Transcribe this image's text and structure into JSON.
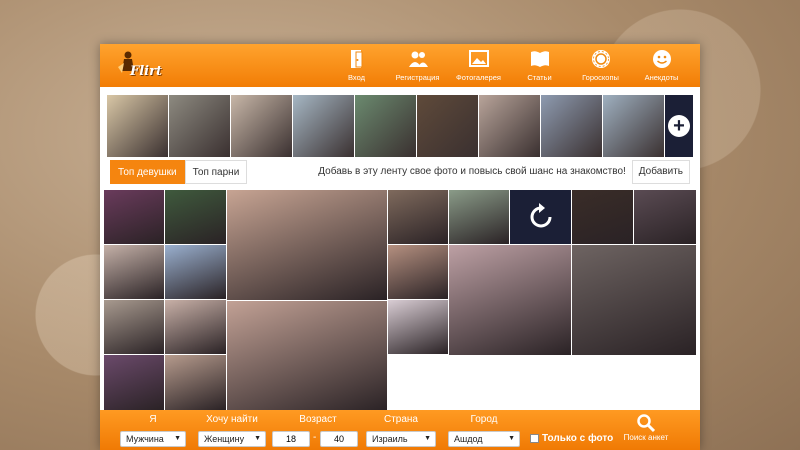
{
  "header": {
    "logo_text": "Flirt",
    "nav": [
      {
        "label": "Вход",
        "icon": "door-icon"
      },
      {
        "label": "Регистрация",
        "icon": "users-icon"
      },
      {
        "label": "Фотогалерея",
        "icon": "image-icon"
      },
      {
        "label": "Статьи",
        "icon": "book-icon"
      },
      {
        "label": "Гороскопы",
        "icon": "zodiac-icon"
      },
      {
        "label": "Анекдоты",
        "icon": "smile-icon"
      }
    ]
  },
  "strip": {
    "photos": [
      "#d9c7a6",
      "#8d8a80",
      "#c8b7a8",
      "#a6b7c4",
      "#6b8a6f",
      "#5f4a3a",
      "#b8a49a",
      "#8e9bb0",
      "#9fb0c0"
    ],
    "add_icon": "plus-icon"
  },
  "tabs": {
    "top_girls": "Топ девушки",
    "top_guys": "Топ парни",
    "promo": "Добавь в эту ленту свое фото и повысь свой шанс на знакомство!",
    "add_button": "Добавить"
  },
  "grid": {
    "refresh_icon": "refresh-icon",
    "colors": [
      "#6a3b5c",
      "#3f5a3d",
      "#c7a493",
      "#7f6a5d",
      "#8a9b88",
      "#3a2d28",
      "#5a4b53",
      "#c5b1a8",
      "#9ab0cf",
      "#b59080",
      "#bda0a4",
      "#6e6462",
      "#a89a8f",
      "#c8b0a7",
      "#c2a195",
      "#d9cdd4",
      "#6b4a6b",
      "#b69b8d",
      "#d2c0b7"
    ]
  },
  "filter": {
    "i_label": "Я",
    "i_value": "Мужчина",
    "want_label": "Хочу найти",
    "want_value": "Женщину",
    "age_label": "Возраст",
    "age_from": "18",
    "age_to": "40",
    "country_label": "Страна",
    "country_value": "Израиль",
    "city_label": "Город",
    "city_value": "Ашдод",
    "photo_only": "Только с фото",
    "search_label": "Поиск анкет"
  }
}
